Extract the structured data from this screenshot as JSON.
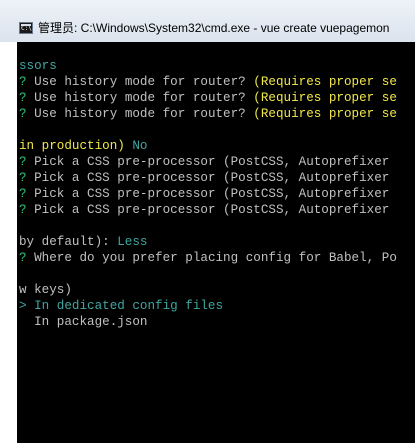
{
  "window": {
    "title": "管理员: C:\\Windows\\System32\\cmd.exe - vue  create vuepagemon"
  },
  "console": {
    "lines": [
      {
        "segments": [
          {
            "text": "ssors",
            "color": "#3fa6a0"
          }
        ]
      },
      {
        "segments": [
          {
            "text": "? ",
            "color": "#2ec47a"
          },
          {
            "text": "Use history mode for router? ",
            "color": "#c0c0c0"
          },
          {
            "text": "(Requires proper se",
            "color": "#f0e84a"
          }
        ]
      },
      {
        "segments": [
          {
            "text": "? ",
            "color": "#2ec47a"
          },
          {
            "text": "Use history mode for router? ",
            "color": "#c0c0c0"
          },
          {
            "text": "(Requires proper se",
            "color": "#f0e84a"
          }
        ]
      },
      {
        "segments": [
          {
            "text": "? ",
            "color": "#2ec47a"
          },
          {
            "text": "Use history mode for router? ",
            "color": "#c0c0c0"
          },
          {
            "text": "(Requires proper se",
            "color": "#f0e84a"
          }
        ]
      },
      {
        "segments": []
      },
      {
        "segments": [
          {
            "text": "in production) ",
            "color": "#f0e84a"
          },
          {
            "text": "No",
            "color": "#3fa6a0"
          }
        ]
      },
      {
        "segments": [
          {
            "text": "? ",
            "color": "#2ec47a"
          },
          {
            "text": "Pick a CSS pre-processor (PostCSS, Autoprefixer",
            "color": "#c0c0c0"
          }
        ]
      },
      {
        "segments": [
          {
            "text": "? ",
            "color": "#2ec47a"
          },
          {
            "text": "Pick a CSS pre-processor (PostCSS, Autoprefixer",
            "color": "#c0c0c0"
          }
        ]
      },
      {
        "segments": [
          {
            "text": "? ",
            "color": "#2ec47a"
          },
          {
            "text": "Pick a CSS pre-processor (PostCSS, Autoprefixer",
            "color": "#c0c0c0"
          }
        ]
      },
      {
        "segments": [
          {
            "text": "? ",
            "color": "#2ec47a"
          },
          {
            "text": "Pick a CSS pre-processor (PostCSS, Autoprefixer",
            "color": "#c0c0c0"
          }
        ]
      },
      {
        "segments": []
      },
      {
        "segments": [
          {
            "text": "by default): ",
            "color": "#c0c0c0"
          },
          {
            "text": "Less",
            "color": "#3fa6a0"
          }
        ]
      },
      {
        "segments": [
          {
            "text": "? ",
            "color": "#2ec47a"
          },
          {
            "text": "Where do you prefer placing config for Babel, Po",
            "color": "#c0c0c0"
          }
        ]
      },
      {
        "segments": []
      },
      {
        "segments": [
          {
            "text": "w keys)",
            "color": "#c0c0c0"
          }
        ]
      },
      {
        "segments": [
          {
            "text": "> In dedicated config files",
            "color": "#3fa6a0"
          }
        ]
      },
      {
        "segments": [
          {
            "text": "  In package.json",
            "color": "#c0c0c0"
          }
        ]
      }
    ]
  }
}
